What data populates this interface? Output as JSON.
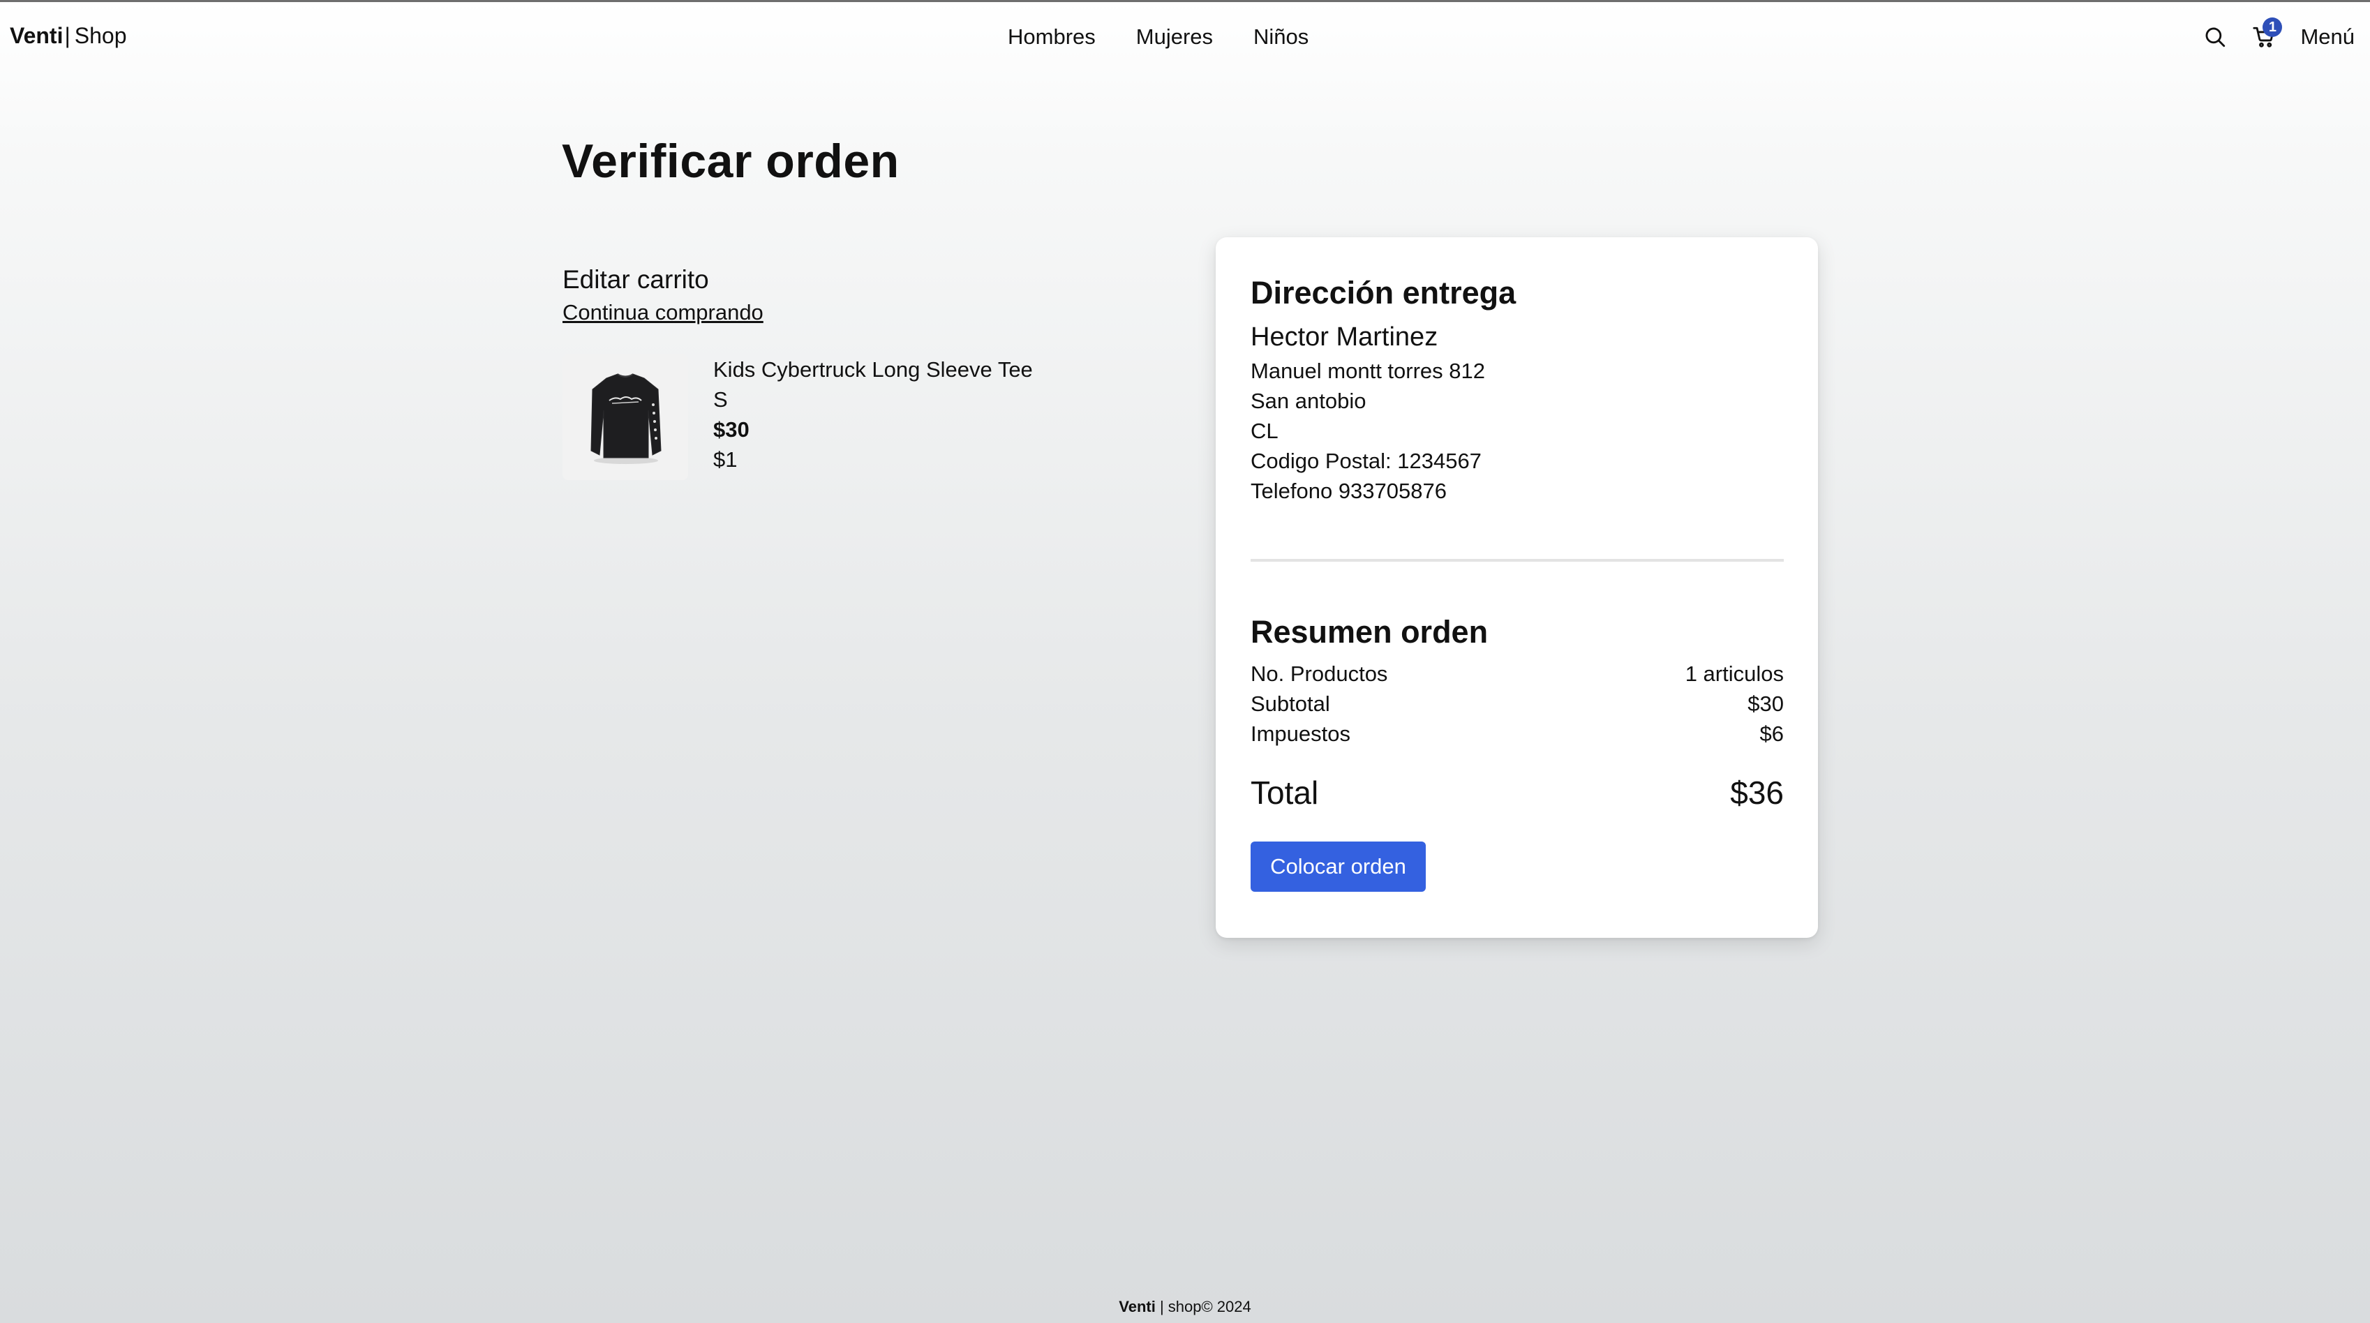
{
  "header": {
    "logo_brand": "Venti",
    "logo_separator": "|",
    "logo_suffix": "Shop",
    "nav": [
      "Hombres",
      "Mujeres",
      "Niños"
    ],
    "cart_count": "1",
    "menu_label": "Menú",
    "icons": {
      "search": "search-icon",
      "cart": "cart-icon"
    },
    "badge_color": "#2e4fb8"
  },
  "page": {
    "title": "Verificar orden"
  },
  "cart": {
    "heading": "Editar carrito",
    "continue_link": "Continua comprando",
    "items": [
      {
        "name": "Kids Cybertruck Long Sleeve Tee",
        "size": "S",
        "price": "$30",
        "quantity": "$1"
      }
    ]
  },
  "delivery": {
    "heading": "Dirección entrega",
    "name": "Hector Martinez",
    "lines": [
      "Manuel montt torres 812",
      "San antobio",
      "CL",
      "Codigo Postal: 1234567",
      "Telefono 933705876"
    ]
  },
  "summary": {
    "heading": "Resumen orden",
    "rows": [
      {
        "label": "No. Productos",
        "value": "1 articulos"
      },
      {
        "label": "Subtotal",
        "value": "$30"
      },
      {
        "label": "Impuestos",
        "value": "$6"
      }
    ],
    "total_label": "Total",
    "total_value": "$36",
    "button_label": "Colocar orden",
    "button_color": "#3461e0"
  },
  "footer": {
    "brand": "Venti",
    "text": "| shop© 2024"
  }
}
